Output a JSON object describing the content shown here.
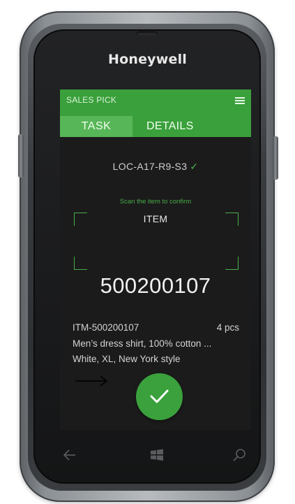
{
  "device": {
    "brand": "Honeywell"
  },
  "app": {
    "title": "SALES PICK",
    "tabs": [
      {
        "label": "TASK",
        "active": true
      },
      {
        "label": "DETAILS",
        "active": false
      }
    ]
  },
  "task": {
    "location": "LOC-A17-R9-S3",
    "location_check": "✓",
    "scan_hint": "Scan the item to confirm",
    "item_label": "ITEM",
    "item_code": "500200107",
    "item_id": "ITM-500200107",
    "quantity": "4 pcs",
    "description": "Men’s dress shirt, 100% cotton ...",
    "attributes": "White, XL, New York style"
  },
  "icons": {
    "menu": "hamburger-menu-icon",
    "location_check": "checkmark-icon",
    "arrow": "right-arrow-icon",
    "confirm": "checkmark-icon",
    "nav_back": "back-arrow-icon",
    "nav_home": "windows-logo-icon",
    "nav_search": "search-icon"
  },
  "colors": {
    "accent": "#3aa03c",
    "active_tab": "#57b657",
    "screen_bg": "#1b1b1b",
    "hint_green": "#49ad49"
  }
}
